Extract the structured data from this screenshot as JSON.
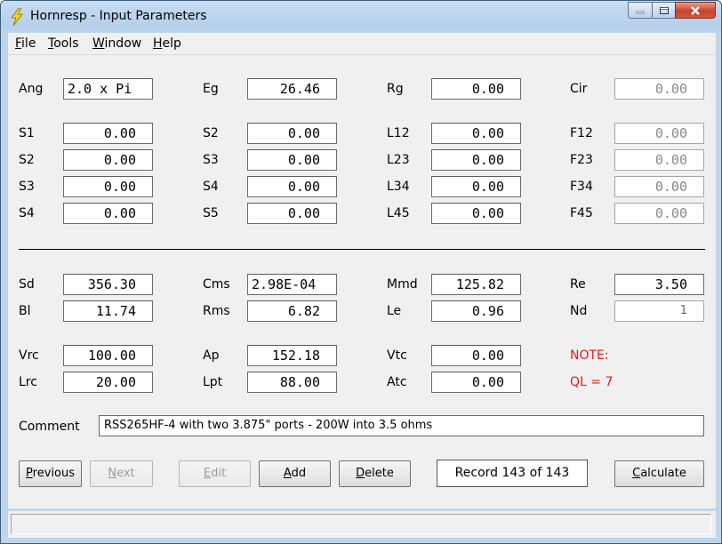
{
  "window": {
    "title": "Hornresp - Input Parameters"
  },
  "menu": [
    {
      "label": "File",
      "key": "F",
      "rest": "ile"
    },
    {
      "label": "Tools",
      "key": "T",
      "rest": "ools"
    },
    {
      "label": "Window",
      "key": "W",
      "rest": "indow"
    },
    {
      "label": "Help",
      "key": "H",
      "rest": "elp"
    }
  ],
  "params": {
    "Ang": "2.0 x Pi",
    "Eg": "26.46",
    "Rg": "0.00",
    "Cir": "0.00",
    "S1a": "0.00",
    "S2b": "0.00",
    "L12": "0.00",
    "F12": "0.00",
    "S2a": "0.00",
    "S3b": "0.00",
    "L23": "0.00",
    "F23": "0.00",
    "S3a": "0.00",
    "S4b": "0.00",
    "L34": "0.00",
    "F34": "0.00",
    "S4a": "0.00",
    "S5b": "0.00",
    "L45": "0.00",
    "F45": "0.00",
    "Sd": "356.30",
    "Cms": "2.98E-04",
    "Mmd": "125.82",
    "Re": "3.50",
    "Bl": "11.74",
    "Rms": "6.82",
    "Le": "0.96",
    "Nd": "1",
    "Vrc": "100.00",
    "Ap": "152.18",
    "Vtc": "0.00",
    "Lrc": "20.00",
    "Lpt": "88.00",
    "Atc": "0.00"
  },
  "labels": {
    "Ang": "Ang",
    "Eg": "Eg",
    "Rg": "Rg",
    "Cir": "Cir",
    "S1": "S1",
    "S2": "S2",
    "S3": "S3",
    "S4": "S4",
    "S5": "S5",
    "L12": "L12",
    "L23": "L23",
    "L34": "L34",
    "L45": "L45",
    "F12": "F12",
    "F23": "F23",
    "F34": "F34",
    "F45": "F45",
    "Sd": "Sd",
    "Cms": "Cms",
    "Mmd": "Mmd",
    "Re": "Re",
    "Bl": "Bl",
    "Rms": "Rms",
    "Le": "Le",
    "Nd": "Nd",
    "Vrc": "Vrc",
    "Ap": "Ap",
    "Vtc": "Vtc",
    "Lrc": "Lrc",
    "Lpt": "Lpt",
    "Atc": "Atc",
    "note": "NOTE:",
    "ql": "QL = 7",
    "comment": "Comment"
  },
  "comment_value": "RSS265HF-4 with two 3.875\" ports - 200W into 3.5 ohms",
  "buttons": {
    "previous": {
      "key": "P",
      "rest": "revious"
    },
    "next": {
      "key": "N",
      "rest": "ext"
    },
    "edit": {
      "key": "E",
      "rest": "dit"
    },
    "add": {
      "key": "A",
      "rest": "dd"
    },
    "delete": {
      "key": "D",
      "rest": "elete"
    },
    "calculate": {
      "key": "C",
      "rest": "alculate"
    }
  },
  "record": "Record 143 of 143",
  "colors": {
    "note_red": "#e21a1a",
    "titlebar": "#c6dcf2",
    "close_button": "#c7402a"
  }
}
